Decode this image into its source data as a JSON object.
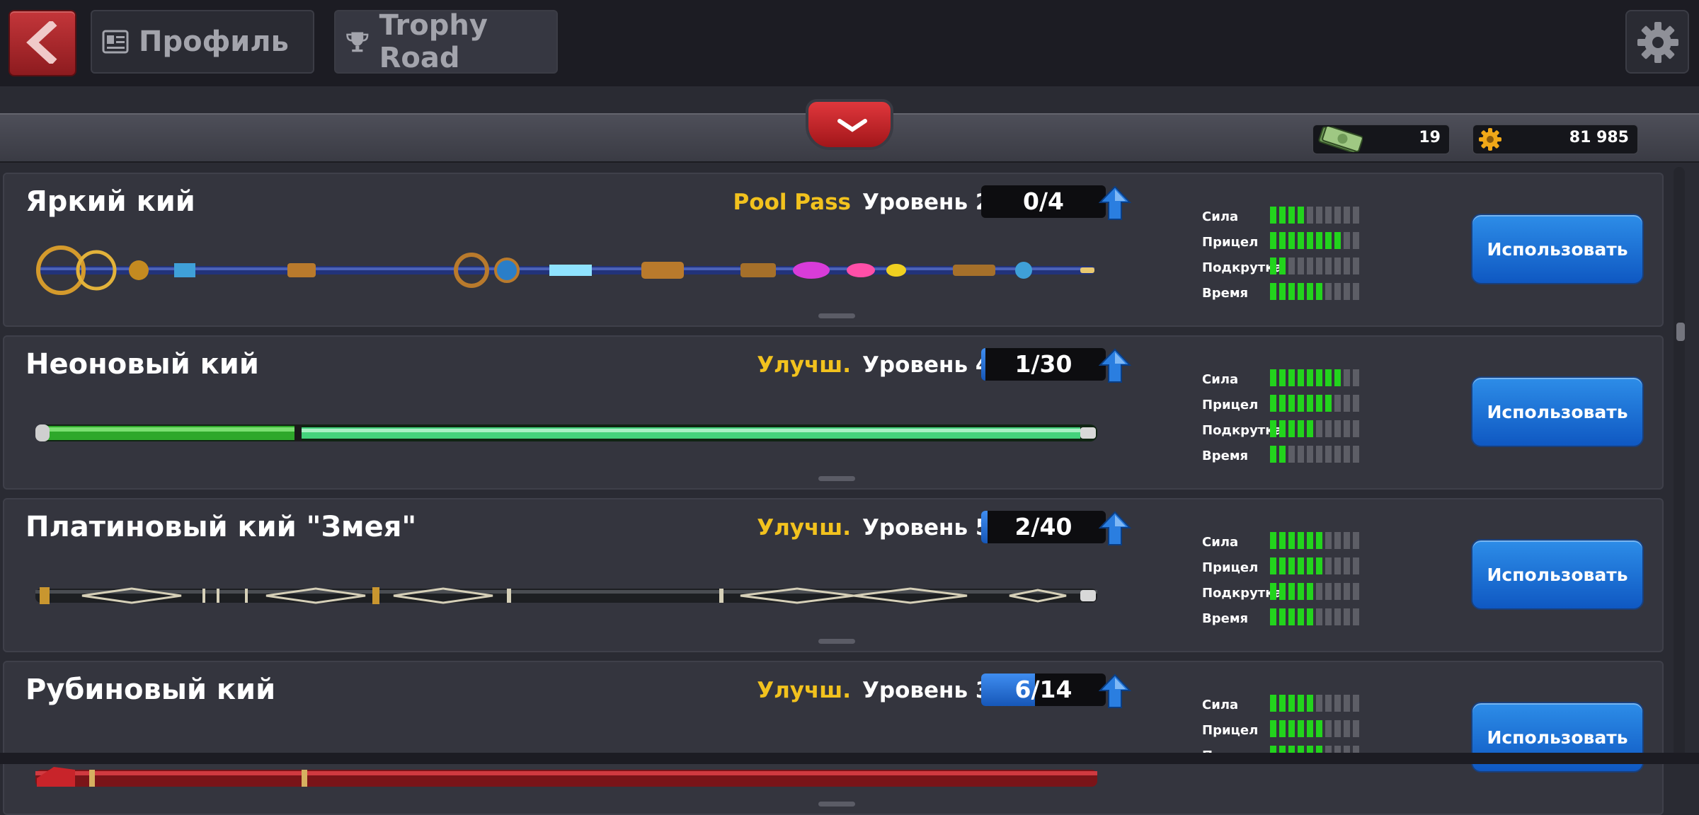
{
  "nav": {
    "back_icon": "back-arrow-icon",
    "tabs": [
      {
        "label": "Профиль",
        "icon": "profile-card-icon"
      },
      {
        "label": "Trophy Road",
        "icon": "trophy-icon"
      }
    ],
    "settings_icon": "gear-icon"
  },
  "currency": {
    "cash": {
      "icon": "cash-icon",
      "value": "19"
    },
    "coins": {
      "icon": "coin-icon",
      "value": "81 985"
    }
  },
  "stat_labels": [
    "Сила",
    "Прицел",
    "Подкрутка",
    "Время"
  ],
  "stat_max": 10,
  "cues": [
    {
      "name": "Яркий кий",
      "tag": "Pool Pass",
      "level": "Уровень 2",
      "progress_text": "0/4",
      "progress": 0.0,
      "stats": [
        4,
        8,
        2,
        6
      ],
      "button": "Использовать"
    },
    {
      "name": "Неоновый кий",
      "tag": "Улучш.",
      "level": "Уровень 4",
      "progress_text": "1/30",
      "progress": 0.033,
      "stats": [
        8,
        7,
        5,
        2
      ],
      "button": "Использовать"
    },
    {
      "name": "Платиновый кий \"Змея\"",
      "tag": "Улучш.",
      "level": "Уровень 5",
      "progress_text": "2/40",
      "progress": 0.05,
      "stats": [
        6,
        6,
        5,
        5
      ],
      "button": "Использовать"
    },
    {
      "name": "Рубиновый кий",
      "tag": "Улучш.",
      "level": "Уровень 3",
      "progress_text": "6/14",
      "progress": 0.43,
      "stats": [
        5,
        6,
        6
      ],
      "button": "Использовать"
    }
  ],
  "colors": {
    "accent_yellow": "#f2c21e",
    "bar_on": "#22d41c",
    "bar_off": "#5d5e66",
    "button_blue": "#1a6fd6",
    "back_red": "#b0282c"
  }
}
